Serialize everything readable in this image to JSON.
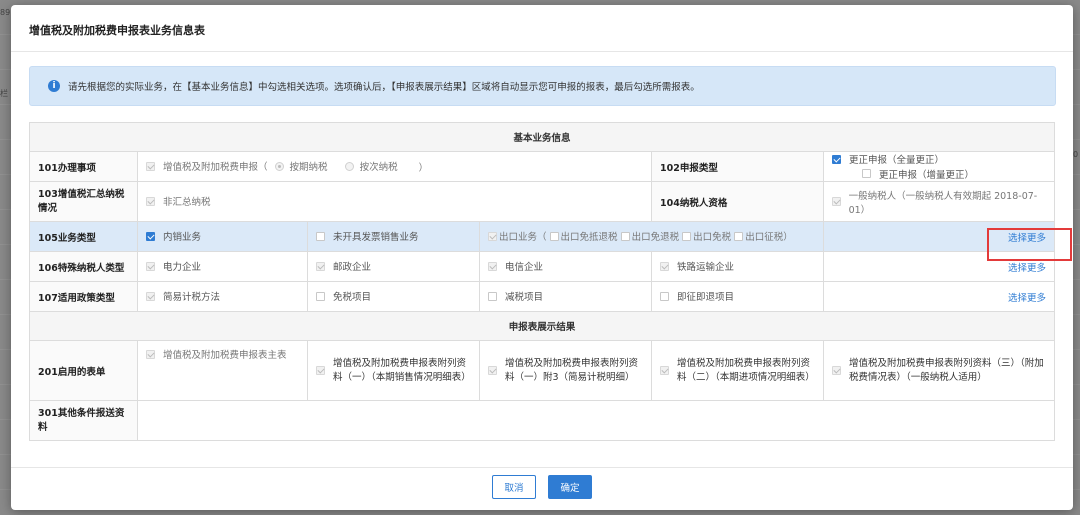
{
  "dialog": {
    "title": "增值税及附加税费申报表业务信息表",
    "notice": "请先根据您的实际业务，在【基本业务信息】中勾选相关选项。选项确认后，【申报表展示结果】区域将自动显示您可申报的报表，最后勾选所需报表。",
    "sections": {
      "basic": "基本业务信息",
      "result": "申报表展示结果"
    },
    "rows": {
      "r101": {
        "label": "101办理事项",
        "option": "增值税及附加税费申报（",
        "radio1": "按期纳税",
        "radio2": "按次纳税",
        "close": "）"
      },
      "r102": {
        "label": "102申报类型",
        "opt1": "更正申报（全量更正）",
        "opt2": "更正申报（增量更正）"
      },
      "r103": {
        "label": "103增值税汇总纳税情况",
        "opt1": "非汇总纳税"
      },
      "r104": {
        "label": "104纳税人资格",
        "opt1": "一般纳税人（一般纳税人有效期起 2018-07-01）"
      },
      "r105": {
        "label": "105业务类型",
        "opt1": "内销业务",
        "opt2": "未开具发票销售业务",
        "opt3": "出口业务（",
        "opt4": "出口免抵退税",
        "opt5": "出口免退税",
        "opt6": "出口免税",
        "opt7": "出口征税）",
        "more": "选择更多"
      },
      "r106": {
        "label": "106特殊纳税人类型",
        "opt1": "电力企业",
        "opt2": "邮政企业",
        "opt3": "电信企业",
        "opt4": "铁路运输企业",
        "more": "选择更多"
      },
      "r107": {
        "label": "107适用政策类型",
        "opt1": "简易计税方法",
        "opt2": "免税项目",
        "opt3": "减税项目",
        "opt4": "即征即退项目",
        "more": "选择更多"
      },
      "r201": {
        "label": "201启用的表单",
        "opt1": "增值税及附加税费申报表主表",
        "opt2": "增值税及附加税费申报表附列资料（一）（本期销售情况明细表）",
        "opt3": "增值税及附加税费申报表附列资料（一）附3（简易计税明细）",
        "opt4": "增值税及附加税费申报表附列资料（二）（本期进项情况明细表）",
        "opt5": "增值税及附加税费申报表附列资料（三）（附加税费情况表）（一般纳税人适用）"
      },
      "r301": {
        "label": "301其他条件报送资料"
      }
    },
    "buttons": {
      "cancel": "取消",
      "ok": "确定"
    }
  },
  "edges": {
    "left1": "89",
    "left2": "栏",
    "right": "0"
  },
  "colors": {
    "accent": "#2f7cd3",
    "highlight_box": "#e33a3a",
    "notice_bg": "#d6e7f8",
    "row_highlight": "#dbe9f8"
  }
}
